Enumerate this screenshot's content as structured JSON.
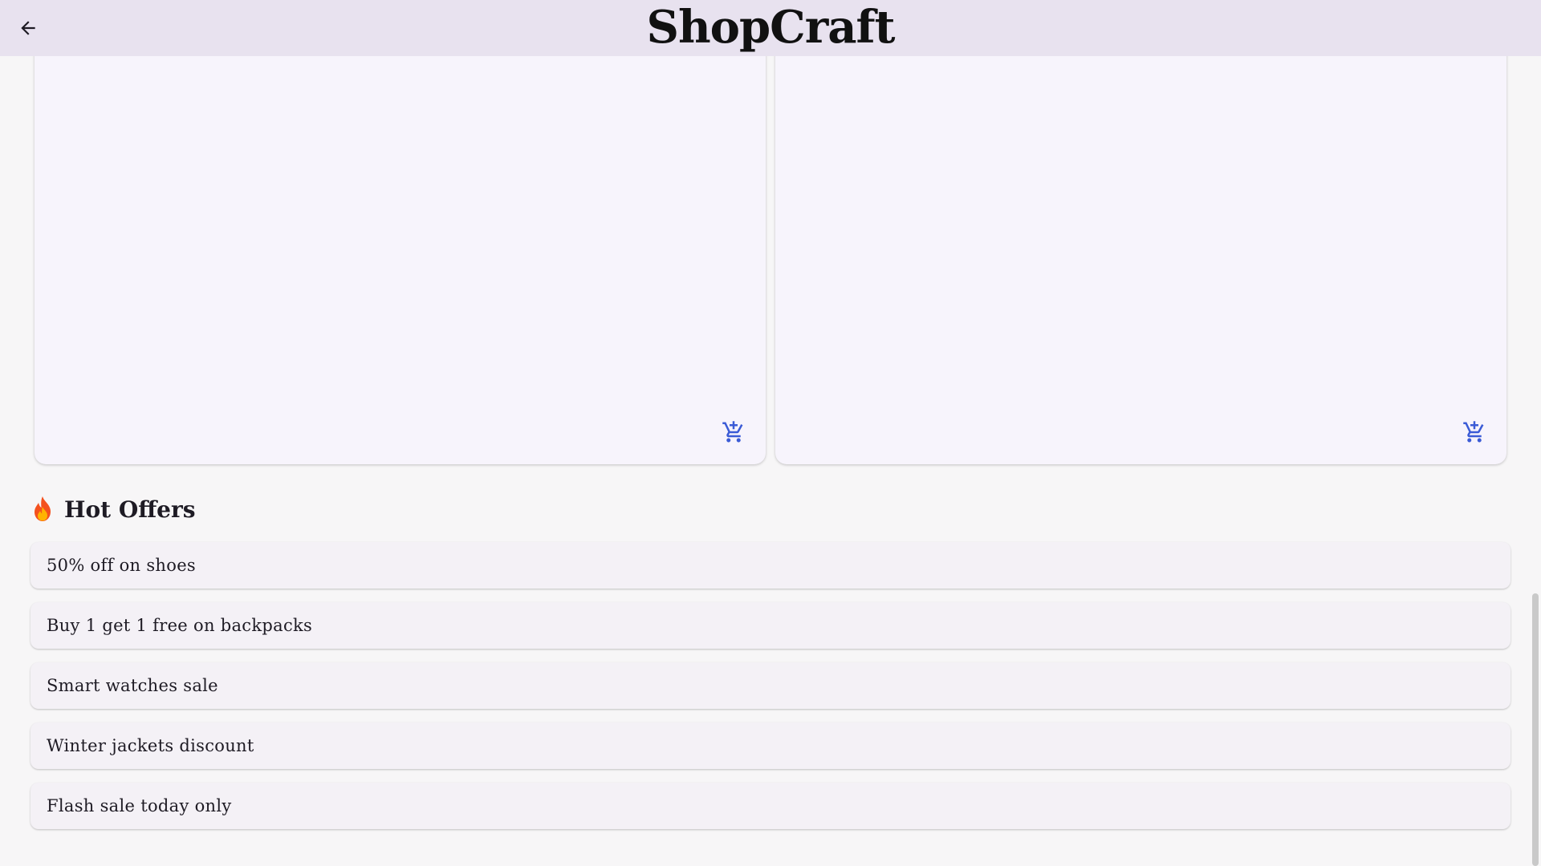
{
  "app": {
    "title": "ShopCraft"
  },
  "icons": {
    "back": "arrow-left-icon",
    "cart": "add-shopping-cart-icon",
    "fire": "fire-icon"
  },
  "colors": {
    "appbar_bg": "#e8e2ef",
    "accent": "#3b5bd6",
    "card_bg": "#f7f4fc"
  },
  "offers": {
    "title": "Hot Offers",
    "items": [
      {
        "label": "50% off on shoes"
      },
      {
        "label": "Buy 1 get 1 free on backpacks"
      },
      {
        "label": "Smart watches sale"
      },
      {
        "label": "Winter jackets discount"
      },
      {
        "label": "Flash sale today only"
      }
    ]
  }
}
